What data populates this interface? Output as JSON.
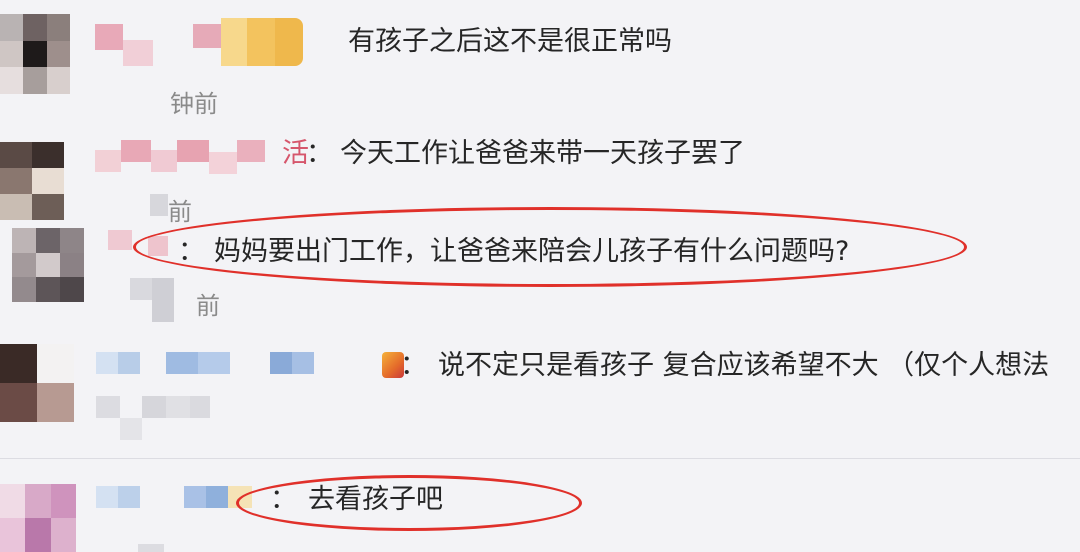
{
  "comments": [
    {
      "text": "有孩子之后这不是很正常吗",
      "meta": "钟前"
    },
    {
      "username_visible": "活",
      "text": "今天工作让爸爸来带一天孩子罢了",
      "meta": "前"
    },
    {
      "text": "妈妈要出门工作，让爸爸来陪会儿孩子有什么问题吗?",
      "meta": "前"
    },
    {
      "text": "说不定只是看孩子 复合应该希望不大 （仅个人想法"
    },
    {
      "text": "去看孩子吧"
    }
  ],
  "separator": "：",
  "colors": {
    "highlight": "#e0302a",
    "background": "#f3f3f6"
  },
  "icons": [
    "avatar",
    "emoji-icon"
  ]
}
